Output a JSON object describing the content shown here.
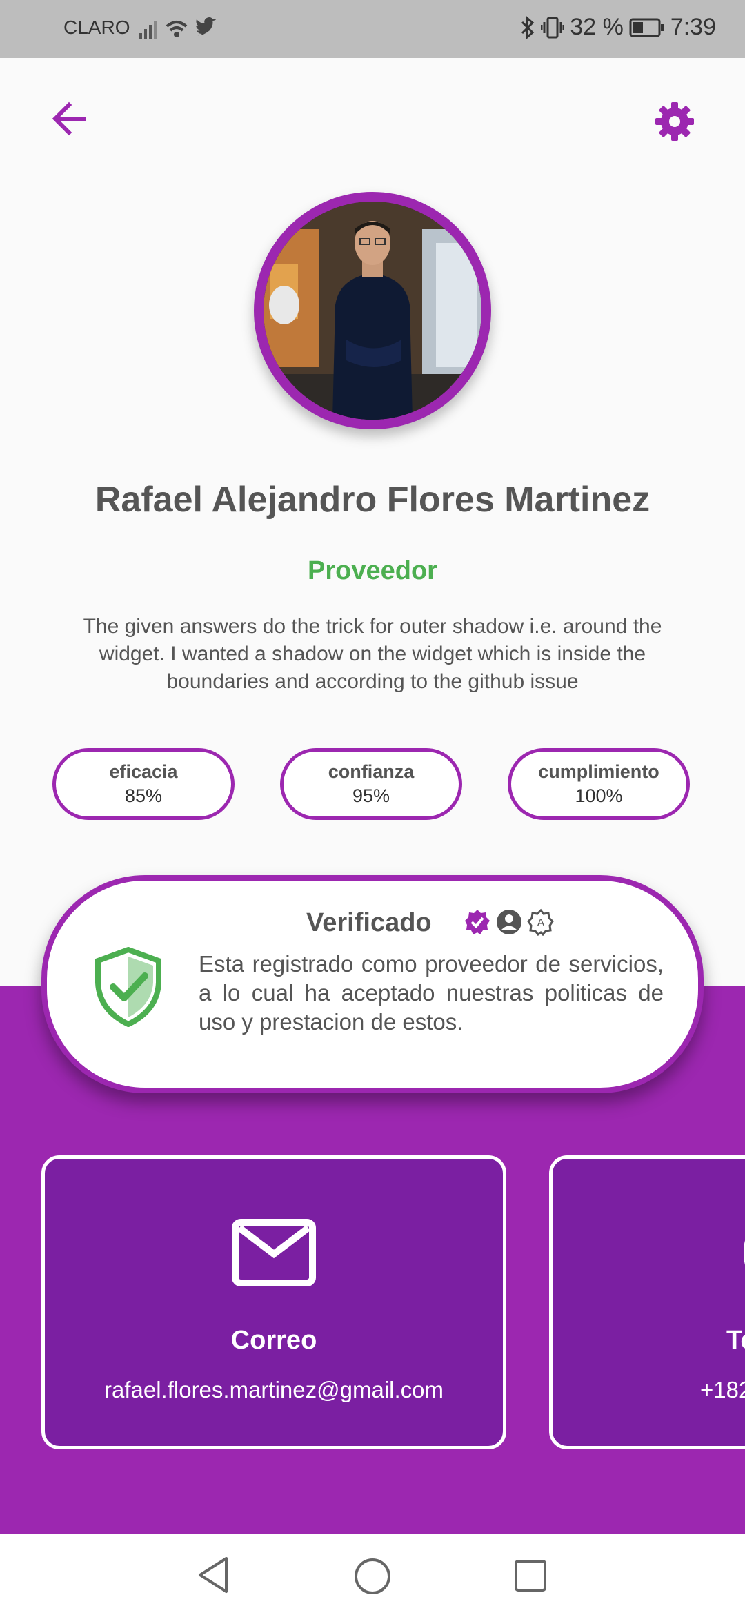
{
  "status_bar": {
    "carrier": "CLARO",
    "battery": "32 %",
    "time": "7:39"
  },
  "header": {
    "back_icon": "arrow-left-icon",
    "settings_icon": "gear-icon"
  },
  "profile": {
    "name": "Rafael Alejandro Flores Martinez",
    "role": "Proveedor",
    "bio": "The given answers do the trick for outer shadow i.e. around the widget. I wanted a shadow on the widget which is inside the boundaries and according to the github issue"
  },
  "stats": [
    {
      "label": "eficacia",
      "value": "85%"
    },
    {
      "label": "confianza",
      "value": "95%"
    },
    {
      "label": "cumplimiento",
      "value": "100%"
    }
  ],
  "verification": {
    "title": "Verificado",
    "text": "Esta registrado como proveedor de servicios, a lo cual ha aceptado nuestras politicas de uso y prestacion de estos."
  },
  "contacts": [
    {
      "title": "Correo",
      "value": "rafael.flores.martinez@gmail.com",
      "icon": "mail-icon"
    },
    {
      "title": "Te",
      "value": "+182",
      "icon": "phone-icon"
    }
  ],
  "colors": {
    "accent": "#9c27b0",
    "accent_dark": "#7b1fa2",
    "success": "#4caf50"
  }
}
